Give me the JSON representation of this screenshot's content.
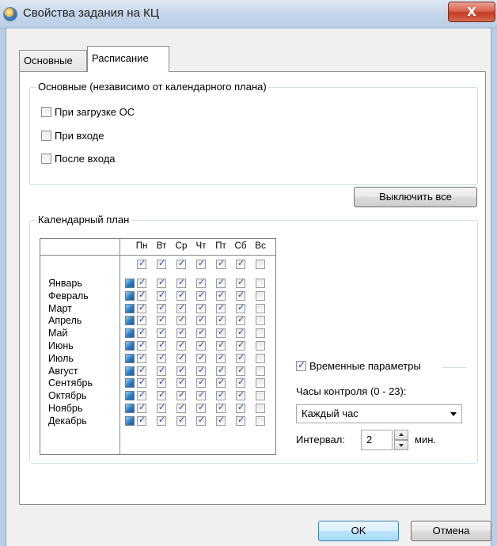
{
  "window": {
    "title": "Свойства задания на КЦ",
    "close_label": "X"
  },
  "tabs": [
    {
      "label": "Основные",
      "active": false
    },
    {
      "label": "Расписание",
      "active": true
    }
  ],
  "basic_group": {
    "title": "Основные (независимо от календарного плана)",
    "options": [
      {
        "label": "При загрузке ОС",
        "checked": false
      },
      {
        "label": "При входе",
        "checked": false
      },
      {
        "label": "После входа",
        "checked": false
      }
    ]
  },
  "disable_all_label": "Выключить все",
  "calendar": {
    "title": "Календарный план",
    "days": [
      "Пн",
      "Вт",
      "Ср",
      "Чт",
      "Пт",
      "Сб",
      "Вс"
    ],
    "day_checked": [
      true,
      true,
      true,
      true,
      true,
      true,
      false
    ],
    "months": [
      "Январь",
      "Февраль",
      "Март",
      "Апрель",
      "Май",
      "Июнь",
      "Июль",
      "Август",
      "Сентябрь",
      "Октябрь",
      "Ноябрь",
      "Декабрь"
    ]
  },
  "time_params": {
    "checkbox_label": "Временные параметры",
    "checked": true,
    "hours_label": "Часы контроля (0 - 23):",
    "hours_value": "Каждый час",
    "interval_label": "Интервал:",
    "interval_value": "2",
    "minutes_label": "мин."
  },
  "footer": {
    "ok_label": "OK",
    "cancel_label": "Отмена"
  }
}
